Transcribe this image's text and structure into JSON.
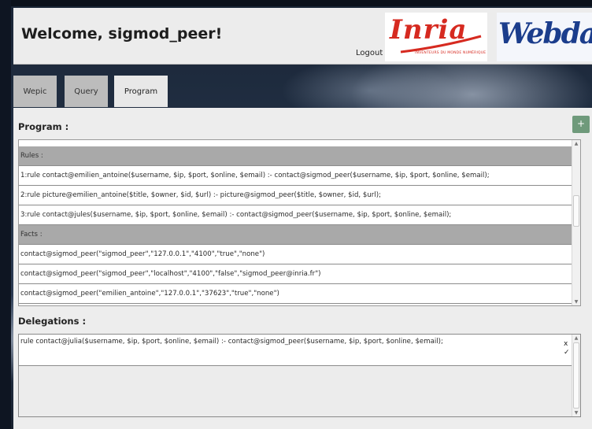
{
  "header": {
    "welcome": "Welcome, sigmod_peer!",
    "logout": "Logout",
    "logos": {
      "inria": "Inria",
      "inria_tagline": "INVENTEURS DU MONDE NUMÉRIQUE",
      "webdam": "Webdam"
    }
  },
  "tabs": [
    {
      "label": "Wepic",
      "active": false
    },
    {
      "label": "Query",
      "active": false
    },
    {
      "label": "Program",
      "active": true
    }
  ],
  "program": {
    "title": "Program :",
    "add_label": "+",
    "rows": [
      {
        "kind": "header",
        "text": "Rules :"
      },
      {
        "kind": "rule",
        "text": "1:rule contact@emilien_antoine($username, $ip, $port, $online, $email) :- contact@sigmod_peer($username, $ip, $port, $online, $email);"
      },
      {
        "kind": "rule",
        "text": "2:rule picture@emilien_antoine($title, $owner, $id, $url) :- picture@sigmod_peer($title, $owner, $id, $url);"
      },
      {
        "kind": "rule",
        "text": "3:rule contact@jules($username, $ip, $port, $online, $email) :- contact@sigmod_peer($username, $ip, $port, $online, $email);"
      },
      {
        "kind": "header",
        "text": "Facts :"
      },
      {
        "kind": "fact",
        "text": "contact@sigmod_peer(\"sigmod_peer\",\"127.0.0.1\",\"4100\",\"true\",\"none\")"
      },
      {
        "kind": "fact",
        "text": "contact@sigmod_peer(\"sigmod_peer\",\"localhost\",\"4100\",\"false\",\"sigmod_peer@inria.fr\")"
      },
      {
        "kind": "fact",
        "text": "contact@sigmod_peer(\"emilien_antoine\",\"127.0.0.1\",\"37623\",\"true\",\"none\")"
      }
    ]
  },
  "delegations": {
    "title": "Delegations :",
    "items": [
      {
        "text": "rule contact@julia($username, $ip, $port, $online, $email) :- contact@sigmod_peer($username, $ip, $port, $online, $email);",
        "reject_label": "x",
        "accept_label": "✓"
      }
    ]
  },
  "colors": {
    "header_bg": "#ececec",
    "row_header_bg": "#a9a9a9",
    "add_button": "#6f9a7b",
    "inria_red": "#d62a20",
    "webdam_blue": "#1b3d8c"
  }
}
